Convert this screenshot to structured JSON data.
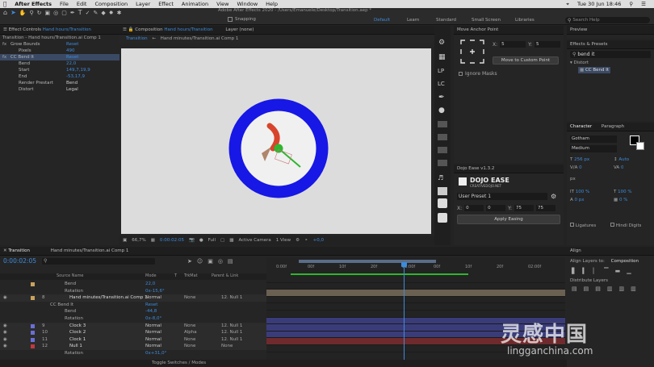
{
  "menubar": {
    "apple": "",
    "app": "After Effects",
    "items": [
      "File",
      "Edit",
      "Composition",
      "Layer",
      "Effect",
      "Animation",
      "View",
      "Window",
      "Help"
    ],
    "clock": "Tue 30 Jun 18:46",
    "search": ""
  },
  "toolbar": {
    "title": "Adobe After Effects 2020 - /Users/Emanuele/Desktop/Transition.aep *",
    "snapping": "Snapping",
    "workspaces": [
      "Default",
      "Learn",
      "Standard",
      "Small Screen",
      "Libraries"
    ],
    "search_placeholder": "Search Help"
  },
  "effect_controls": {
    "tab": "Effect Controls",
    "tab_layer": "Hand hours/Transition",
    "subtitle": "Transition - Hand hours/Transition.ai Comp 1",
    "rows": [
      {
        "fx": "fx",
        "name": "Grow Bounds",
        "value": "Reset"
      },
      {
        "fx": "",
        "name": "Pixels",
        "value": "490"
      },
      {
        "fx": "fx",
        "name": "CC Bend It",
        "value": "Reset"
      },
      {
        "fx": "",
        "name": "Bend",
        "value": "22,0"
      },
      {
        "fx": "",
        "name": "Start",
        "value": "149,7,19,9"
      },
      {
        "fx": "",
        "name": "End",
        "value": "-53,17,9"
      },
      {
        "fx": "",
        "name": "Render Prestart",
        "value": "Bend"
      },
      {
        "fx": "",
        "name": "Distort",
        "value": "Legal"
      }
    ]
  },
  "composition": {
    "tab": "Composition",
    "tab_name": "Hand hours/Transition",
    "layer_tab": "Layer (none)",
    "breadcrumbs": [
      "Transition",
      "Hand minutes/Transition.ai Comp 1"
    ],
    "footer": {
      "zoom": "66,7%",
      "time": "0:00:02:05",
      "quality": "Full",
      "camera": "Active Camera",
      "views": "1 View",
      "exposure": "+0,0"
    }
  },
  "tools_strip": [
    "LP",
    "LC"
  ],
  "anchor_panel": {
    "title": "Move Anchor Point",
    "x_label": "X:",
    "x_value": "5",
    "y_label": "Y:",
    "y_value": "5",
    "button": "Move to Custom Point",
    "ignore_masks": "Ignore Masks"
  },
  "dojo": {
    "title": "Dojo Ease v1.3.2",
    "brand": "DOJO EASE",
    "brand_sub": "CREATIVEDOJO.NET",
    "preset": "User Preset 1",
    "fields": [
      "0",
      "0",
      "75",
      "75"
    ],
    "field_labels": [
      "X:",
      "Y:"
    ],
    "apply": "Apply Easing"
  },
  "preview": {
    "title": "Preview"
  },
  "effects_presets": {
    "title": "Effects & Presets",
    "search": "bend it",
    "category": "Distort",
    "item": "CC Bend It"
  },
  "character": {
    "tabs": [
      "Character",
      "Paragraph"
    ],
    "font": "Gotham",
    "style": "Medium",
    "size": "256 px",
    "leading": "Auto",
    "kerning": "0",
    "tracking": "0",
    "unit": "px",
    "vscale": "100 %",
    "hscale": "100 %",
    "baseline": "0 px",
    "tsume": "0 %",
    "ligatures": "Ligatures",
    "hindi": "Hindi Digits"
  },
  "align": {
    "title": "Align",
    "align_to_label": "Align Layers to:",
    "align_to": "Composition",
    "distribute": "Distribute Layers"
  },
  "timeline": {
    "tab": "Transition",
    "tab2": "Hand minutes/Transition.ai Comp 1",
    "current_time": "0:00:02:05",
    "search": "",
    "columns": {
      "source": "Source Name",
      "mode": "Mode",
      "t": "T",
      "trkmat": "TrkMat",
      "parent": "Parent & Link"
    },
    "ruler": [
      "0:00f",
      "00f",
      "10f",
      "20f",
      "01:00f",
      "00f",
      "10f",
      "20f",
      "02:00f"
    ],
    "footer": "Toggle Switches / Modes",
    "layers": [
      {
        "num": "",
        "name": "Bend",
        "mode": "22,0",
        "trk": "",
        "parent": "",
        "kind": "prop",
        "color": "#c9a35c"
      },
      {
        "num": "",
        "name": "Rotation",
        "mode": "0x-15,6°",
        "trk": "",
        "parent": "",
        "kind": "prop",
        "color": ""
      },
      {
        "num": "8",
        "name": "Hand minutes/Transition.ai Comp 1",
        "mode": "Normal",
        "trk": "None",
        "parent": "12. Null 1",
        "kind": "layer",
        "color": "#c9a35c"
      },
      {
        "num": "",
        "name": "CC Bend It",
        "mode": "Reset",
        "trk": "",
        "parent": "",
        "kind": "fx",
        "color": ""
      },
      {
        "num": "",
        "name": "Bend",
        "mode": "-44,8",
        "trk": "",
        "parent": "",
        "kind": "prop",
        "color": ""
      },
      {
        "num": "",
        "name": "Rotation",
        "mode": "0x-8,0°",
        "trk": "",
        "parent": "",
        "kind": "prop",
        "color": ""
      },
      {
        "num": "9",
        "name": "Clock 3",
        "mode": "Normal",
        "trk": "None",
        "parent": "12. Null 1",
        "kind": "layer",
        "color": "#6a6fd6"
      },
      {
        "num": "10",
        "name": "Clock 2",
        "mode": "Normal",
        "trk": "Alpha",
        "parent": "12. Null 1",
        "kind": "layer",
        "color": "#6a6fd6"
      },
      {
        "num": "11",
        "name": "Clock 1",
        "mode": "Normal",
        "trk": "None",
        "parent": "12. Null 1",
        "kind": "layer",
        "color": "#6a6fd6"
      },
      {
        "num": "12",
        "name": "Null 1",
        "mode": "Normal",
        "trk": "None",
        "parent": "None",
        "kind": "layer",
        "color": "#c0393f"
      },
      {
        "num": "",
        "name": "Rotation",
        "mode": "0x+31,0°",
        "trk": "",
        "parent": "",
        "kind": "prop",
        "color": ""
      }
    ]
  },
  "colors": {
    "accent": "#3d8bda",
    "ring": "#1717e6",
    "hand_red": "#d8442b",
    "hand_green": "#2fb52f",
    "comp_bg": "#dcdcdc"
  },
  "watermark": {
    "cn": "灵感中国",
    "en": "lingganchina.com"
  }
}
